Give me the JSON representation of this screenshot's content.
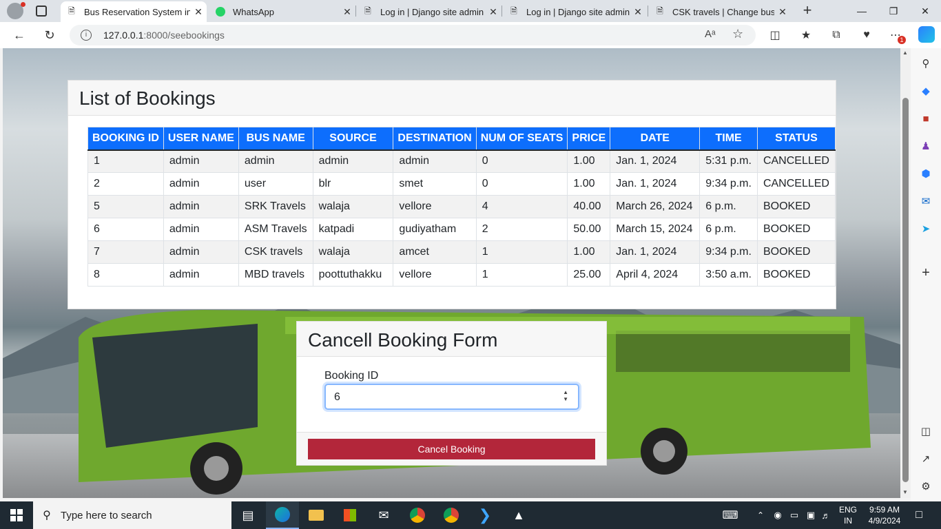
{
  "browser": {
    "tabs": [
      {
        "title": "Bus Reservation System in D",
        "icon": "page-icon",
        "active": true
      },
      {
        "title": "WhatsApp",
        "icon": "whatsapp-icon",
        "active": false
      },
      {
        "title": "Log in | Django site admin",
        "icon": "page-icon",
        "active": false
      },
      {
        "title": "Log in | Django site admin",
        "icon": "page-icon",
        "active": false
      },
      {
        "title": "CSK travels | Change bus | D",
        "icon": "page-icon",
        "active": false
      }
    ],
    "url_host": "127.0.0.1",
    "url_rest": ":8000/seebookings",
    "notification_badge": "1"
  },
  "bookings": {
    "title": "List of Bookings",
    "columns": [
      "BOOKING ID",
      "USER NAME",
      "BUS NAME",
      "SOURCE",
      "DESTINATION",
      "NUM OF SEATS",
      "PRICE",
      "DATE",
      "TIME",
      "STATUS"
    ],
    "rows": [
      [
        "1",
        "admin",
        "admin",
        "admin",
        "admin",
        "0",
        "1.00",
        "Jan. 1, 2024",
        "5:31 p.m.",
        "CANCELLED"
      ],
      [
        "2",
        "admin",
        "user",
        "blr",
        "smet",
        "0",
        "1.00",
        "Jan. 1, 2024",
        "9:34 p.m.",
        "CANCELLED"
      ],
      [
        "5",
        "admin",
        "SRK Travels",
        "walaja",
        "vellore",
        "4",
        "40.00",
        "March 26, 2024",
        "6 p.m.",
        "BOOKED"
      ],
      [
        "6",
        "admin",
        "ASM Travels",
        "katpadi",
        "gudiyatham",
        "2",
        "50.00",
        "March 15, 2024",
        "6 p.m.",
        "BOOKED"
      ],
      [
        "7",
        "admin",
        "CSK travels",
        "walaja",
        "amcet",
        "1",
        "1.00",
        "Jan. 1, 2024",
        "9:34 p.m.",
        "BOOKED"
      ],
      [
        "8",
        "admin",
        "MBD travels",
        "poottuthakku",
        "vellore",
        "1",
        "25.00",
        "April 4, 2024",
        "3:50 a.m.",
        "BOOKED"
      ]
    ]
  },
  "cancel_form": {
    "title": "Cancell Booking Form",
    "label": "Booking ID",
    "value": "6",
    "button": "Cancel Booking"
  },
  "taskbar": {
    "search_placeholder": "Type here to search",
    "lang": "ENG",
    "region": "IN",
    "time": "9:59 AM",
    "date": "4/9/2024"
  },
  "colors": {
    "table_header": "#0d6efd",
    "cancel_button": "#b3263a",
    "taskbar": "#1f2a33"
  }
}
